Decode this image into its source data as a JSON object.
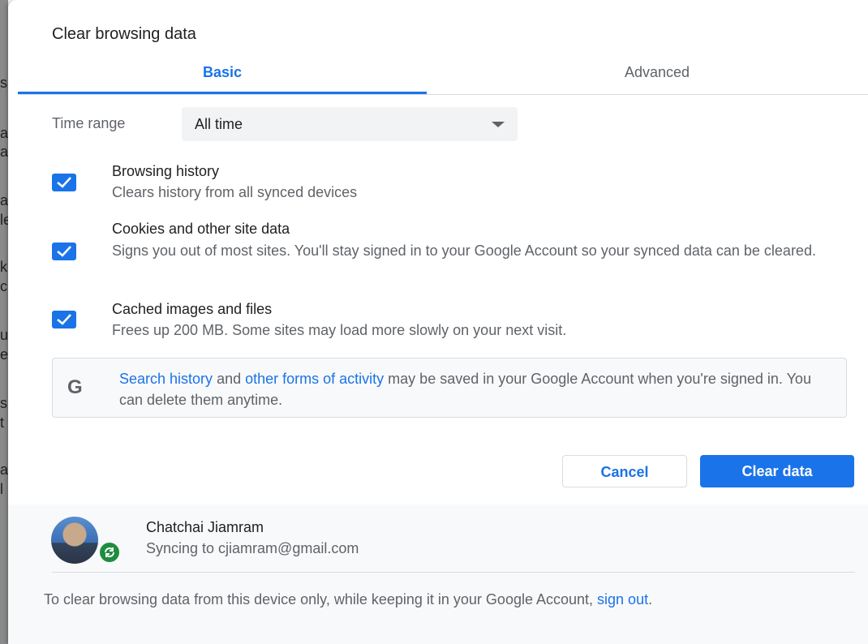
{
  "dialog": {
    "title": "Clear browsing data"
  },
  "tabs": [
    {
      "label": "Basic",
      "active": true
    },
    {
      "label": "Advanced",
      "active": false
    }
  ],
  "time_range": {
    "label": "Time range",
    "value": "All time"
  },
  "options": [
    {
      "title": "Browsing history",
      "description": "Clears history from all synced devices",
      "checked": true
    },
    {
      "title": "Cookies and other site data",
      "description": "Signs you out of most sites. You'll stay signed in to your Google Account so your synced data can be cleared.",
      "checked": true
    },
    {
      "title": "Cached images and files",
      "description": "Frees up 200 MB. Some sites may load more slowly on your next visit.",
      "checked": true
    }
  ],
  "info": {
    "icon": "google-g-icon",
    "link1": "Search history",
    "text1": " and ",
    "link2": "other forms of activity",
    "text2": " may be saved in your Google Account when you're signed in. You can delete them anytime."
  },
  "buttons": {
    "cancel": "Cancel",
    "clear": "Clear data"
  },
  "account": {
    "name": "Chatchai Jiamram",
    "sync_status": "Syncing to cjiamram@gmail.com"
  },
  "footer": {
    "text": "To clear browsing data from this device only, while keeping it in your Google Account, ",
    "link": "sign out",
    "end": "."
  },
  "background": {
    "fragments": [
      "s",
      "a",
      "a",
      "a",
      "le",
      "k",
      "c",
      "u",
      "e",
      "s",
      "t",
      "a",
      "l"
    ]
  },
  "colors": {
    "accent": "#1a73e8",
    "sync_green": "#1e8e3e"
  }
}
